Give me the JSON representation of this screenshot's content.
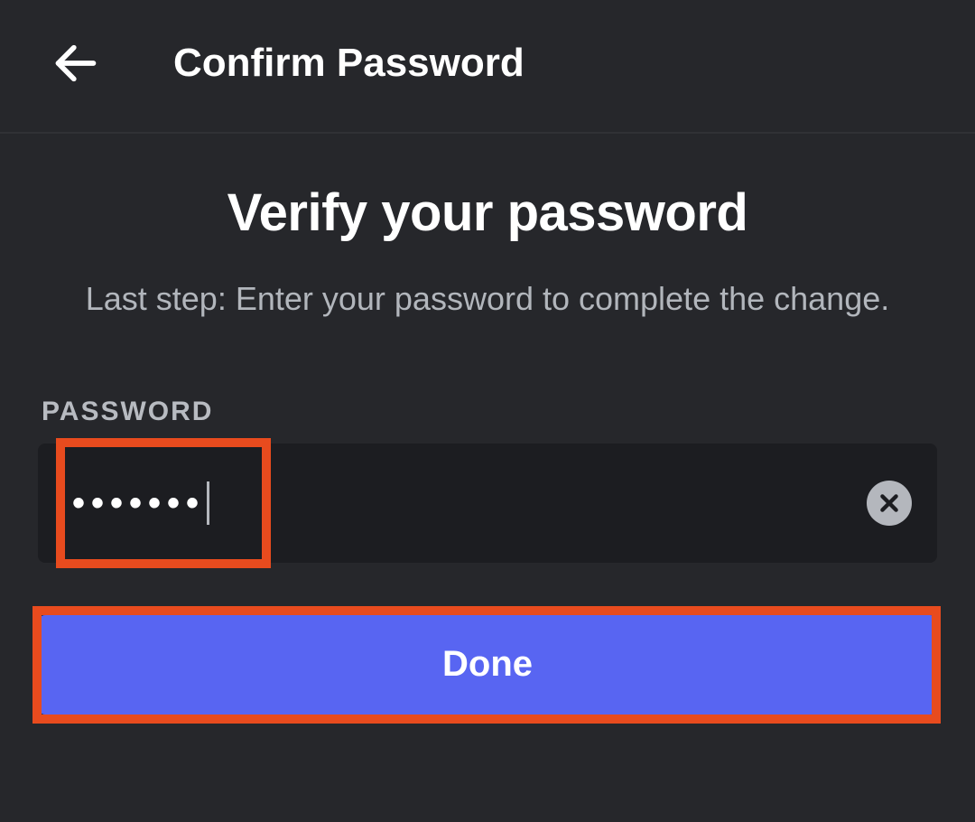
{
  "header": {
    "title": "Confirm Password"
  },
  "main": {
    "title": "Verify your password",
    "subtitle": "Last step: Enter your password to complete the change."
  },
  "password": {
    "label": "PASSWORD",
    "masked_value": "•••••••",
    "value": "*******"
  },
  "actions": {
    "done_label": "Done"
  },
  "icons": {
    "back": "arrow-left",
    "clear": "close"
  },
  "colors": {
    "accent": "#5865f2",
    "highlight": "#e84b1e",
    "bg": "#26272b",
    "input_bg": "#1c1d21"
  }
}
